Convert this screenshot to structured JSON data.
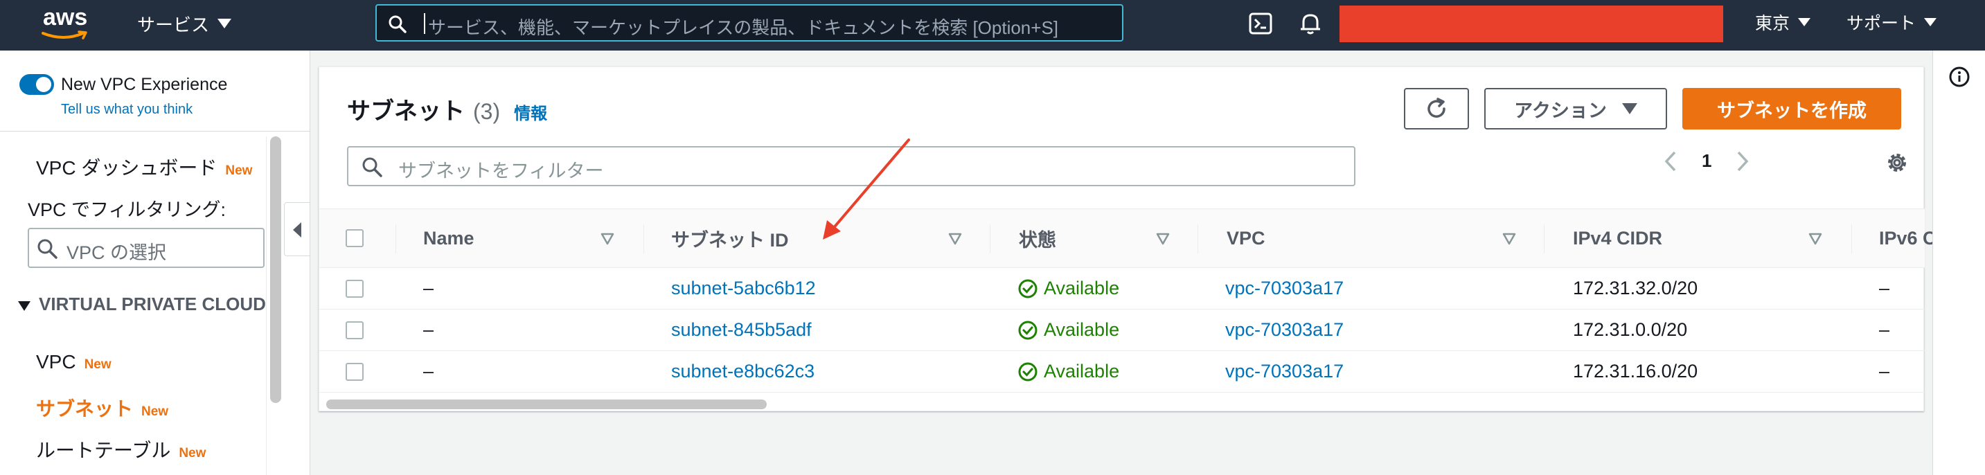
{
  "topnav": {
    "logo_text": "aws",
    "services_label": "サービス",
    "search_placeholder": "サービス、機能、マーケットプレイスの製品、ドキュメントを検索 [Option+S]",
    "cloudshell_icon": "terminal-icon",
    "notifications_icon": "bell-icon",
    "region_label": "東京",
    "support_label": "サポート",
    "colors": {
      "bg": "#232f3e",
      "search_border": "#44b9d6",
      "redaction": "#e8402a"
    }
  },
  "sidebar": {
    "toggle_label": "New VPC Experience",
    "feedback_link": "Tell us what you think",
    "dashboard_label": "VPC ダッシュボード",
    "new_badge": "New",
    "filter_label": "VPC でフィルタリング:",
    "vpc_select_placeholder": "VPC の選択",
    "section_title": "VIRTUAL PRIVATE CLOUD",
    "items": [
      {
        "label": "VPC",
        "badge": "New",
        "active": false
      },
      {
        "label": "サブネット",
        "badge": "New",
        "active": true
      },
      {
        "label": "ルートテーブル",
        "badge": "New",
        "active": false
      }
    ]
  },
  "main": {
    "title": "サブネット",
    "count": "(3)",
    "info_link": "情報",
    "actions_label": "アクション",
    "create_label": "サブネットを作成",
    "filter_placeholder": "サブネットをフィルター",
    "page_number": "1",
    "columns": [
      "Name",
      "サブネット ID",
      "状態",
      "VPC",
      "IPv4 CIDR",
      "IPv6 C"
    ],
    "rows": [
      {
        "name": "–",
        "subnet_id": "subnet-5abc6b12",
        "state": "Available",
        "vpc": "vpc-70303a17",
        "ipv4": "172.31.32.0/20",
        "ipv6": "–"
      },
      {
        "name": "–",
        "subnet_id": "subnet-845b5adf",
        "state": "Available",
        "vpc": "vpc-70303a17",
        "ipv4": "172.31.0.0/20",
        "ipv6": "–"
      },
      {
        "name": "–",
        "subnet_id": "subnet-e8bc62c3",
        "state": "Available",
        "vpc": "vpc-70303a17",
        "ipv4": "172.31.16.0/20",
        "ipv6": "–"
      }
    ],
    "colors": {
      "accent": "#ec7211",
      "link": "#0073bb",
      "available": "#1d8102",
      "annotation_arrow": "#e8402a"
    }
  }
}
